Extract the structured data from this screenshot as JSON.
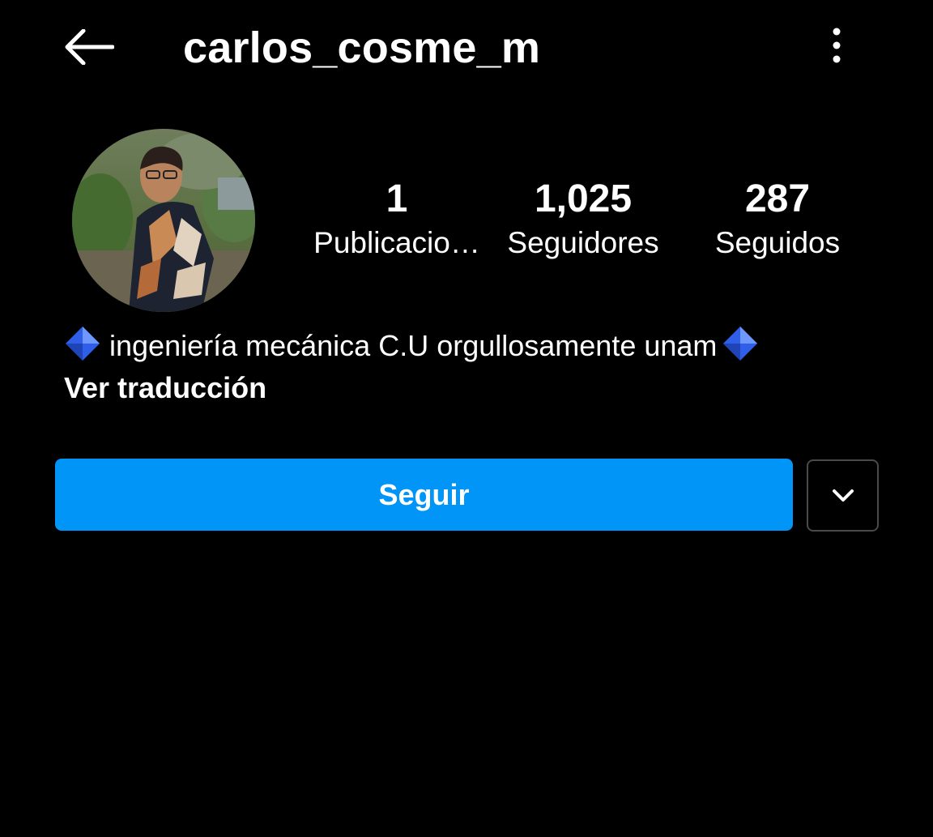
{
  "header": {
    "back_icon": "arrow-left-icon",
    "username": "carlos_cosme_m",
    "more_icon": "vertical-ellipsis-icon"
  },
  "profile": {
    "avatar": "profile-photo",
    "stats": [
      {
        "value": "1",
        "label": "Publicacio…"
      },
      {
        "value": "1,025",
        "label": "Seguidores"
      },
      {
        "value": "287",
        "label": "Seguidos"
      }
    ],
    "bio": {
      "emoji_icon": "blue-diamond-icon",
      "text": "ingeniería mecánica C.U orgullosamente unam",
      "translate_label": "Ver traducción"
    }
  },
  "actions": {
    "follow_label": "Seguir",
    "dropdown_icon": "chevron-down-icon"
  },
  "colors": {
    "background": "#000000",
    "text": "#ffffff",
    "accent": "#0095f6",
    "border": "#4a4a4a",
    "diamond": "#3b6ff5"
  }
}
